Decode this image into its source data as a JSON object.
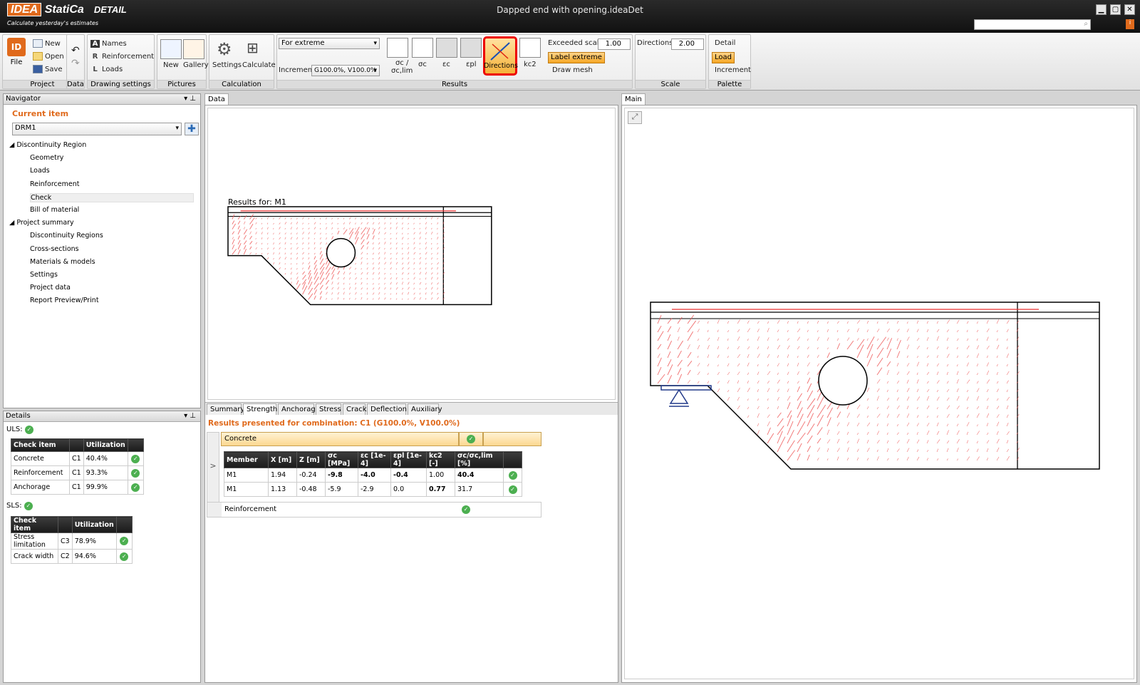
{
  "app": {
    "brand1": "IDEA",
    "brand2": "StatiCa",
    "module": "DETAIL",
    "tagline": "Calculate yesterday's estimates",
    "window_title": "Dapped end with opening.ideaDet",
    "search_placeholder": "",
    "info": "i",
    "min": "▁",
    "max": "▢",
    "close": "✕"
  },
  "ribbon": {
    "project": {
      "file": "File",
      "new": "New",
      "open": "Open",
      "save": "Save",
      "label": "Project"
    },
    "data": {
      "label": "Data",
      "undo": "↶",
      "redo": "↷"
    },
    "drawing": {
      "names": "Names",
      "reinforcement": "Reinforcement",
      "loads": "Loads",
      "label": "Drawing settings",
      "n": "A",
      "r": "R",
      "l": "L"
    },
    "pictures": {
      "new": "New",
      "gallery": "Gallery",
      "label": "Pictures"
    },
    "calculation": {
      "settings": "Settings",
      "calculate": "Calculate",
      "label": "Calculation"
    },
    "results": {
      "extreme": "For extreme",
      "increment_label": "Increment",
      "increment": "G100.0%, V100.0%",
      "sigma_ratio": "σc /",
      "sigma_ratio2": "σc,lim",
      "sigma": "σc",
      "eps": "εc",
      "epl": "εpl",
      "directions": "Directions",
      "kc2": "kc2",
      "exceeded_label": "Exceeded scale",
      "exceeded": "1.00",
      "label_extreme": "Label extreme",
      "draw_mesh": "Draw mesh",
      "label": "Results"
    },
    "scale": {
      "directions_label": "Directions",
      "directions": "2.00",
      "label": "Scale"
    },
    "palette": {
      "detail": "Detail",
      "load": "Load",
      "increment": "Increment",
      "label": "Palette"
    }
  },
  "navigator": {
    "title": "Navigator",
    "current_item": "Current item",
    "item": "DRM1",
    "tree": [
      {
        "label": "Discontinuity Region",
        "level": 0
      },
      {
        "label": "Geometry",
        "level": 1
      },
      {
        "label": "Loads",
        "level": 1
      },
      {
        "label": "Reinforcement",
        "level": 1
      },
      {
        "label": "Check",
        "level": 1
      },
      {
        "label": "Bill of material",
        "level": 1
      },
      {
        "label": "Project summary",
        "level": 0
      },
      {
        "label": "Discontinuity Regions",
        "level": 1
      },
      {
        "label": "Cross-sections",
        "level": 1
      },
      {
        "label": "Materials & models",
        "level": 1
      },
      {
        "label": "Settings",
        "level": 1
      },
      {
        "label": "Project data",
        "level": 1
      },
      {
        "label": "Report Preview/Print",
        "level": 1
      }
    ]
  },
  "details": {
    "title": "Details",
    "uls": "ULS:",
    "sls": "SLS:",
    "headers": [
      "Check item",
      "",
      "Utilization",
      ""
    ],
    "uls_rows": [
      [
        "Concrete",
        "C1",
        "40.4%"
      ],
      [
        "Reinforcement",
        "C1",
        "93.3%"
      ],
      [
        "Anchorage",
        "C1",
        "99.9%"
      ]
    ],
    "sls_rows": [
      [
        "Stress limitation",
        "C3",
        "78.9%"
      ],
      [
        "Crack width",
        "C2",
        "94.6%"
      ]
    ]
  },
  "data_panel": {
    "tab": "Data",
    "results_for": "Results for: M1",
    "tabs": [
      "Summary",
      "Strength",
      "Anchorage",
      "Stress",
      "Crack",
      "Deflection",
      "Auxiliary"
    ],
    "combination": "Results presented for combination: C1 (G100.0%, V100.0%)",
    "concrete": "Concrete",
    "reinforcement": "Reinforcement",
    "expander": ">",
    "headers": [
      "Member",
      "X [m]",
      "Z [m]",
      "σc [MPa]",
      "εc [1e-4]",
      "εpl [1e-4]",
      "kc2 [-]",
      "σc/σc,lim [%]",
      ""
    ],
    "rows": [
      [
        "M1",
        "1.94",
        "-0.24",
        "-9.8",
        "-4.0",
        "-0.4",
        "1.00",
        "40.4"
      ],
      [
        "M1",
        "1.13",
        "-0.48",
        "-5.9",
        "-2.9",
        "0.0",
        "0.77",
        "31.7"
      ]
    ]
  },
  "main_panel": {
    "tab": "Main",
    "fit": "⤢"
  }
}
